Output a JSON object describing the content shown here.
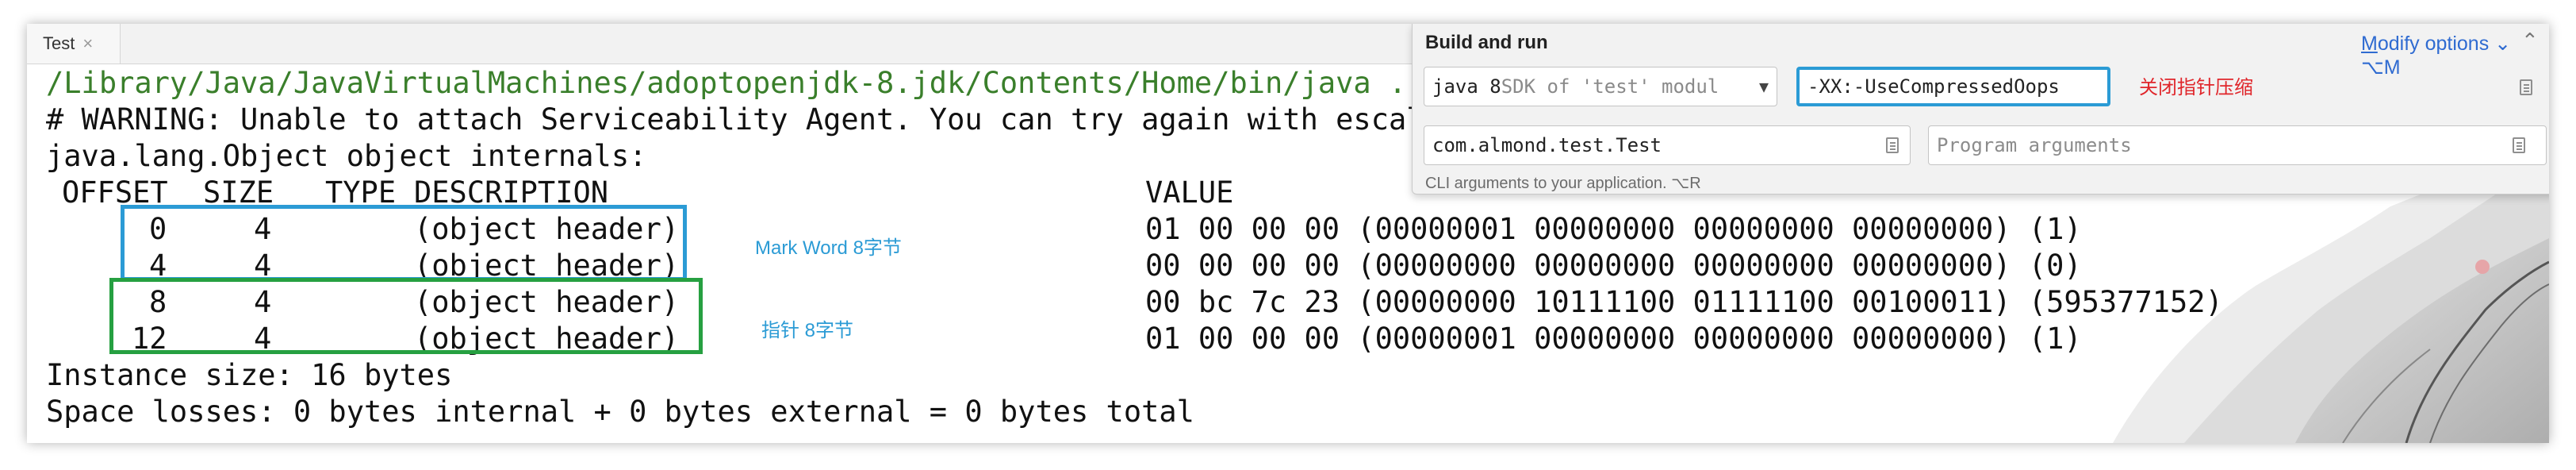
{
  "tabs": [
    {
      "label": "Test",
      "close_glyph": "×"
    }
  ],
  "console": {
    "lines": [
      "/Library/Java/JavaVirtualMachines/adoptopenjdk-8.jdk/Contents/Home/bin/java ...",
      "# WARNING: Unable to attach Serviceability Agent. You can try again with escala",
      "java.lang.Object object internals:"
    ],
    "headers": {
      "offset": "OFFSET",
      "size": "SIZE",
      "type": "TYPE",
      "description": "DESCRIPTION",
      "value": "VALUE"
    },
    "rows": [
      {
        "offset": "0",
        "size": "4",
        "description": "(object header)",
        "value": "01 00 00 00 (00000001 00000000 00000000 00000000) (1)"
      },
      {
        "offset": "4",
        "size": "4",
        "description": "(object header)",
        "value": "00 00 00 00 (00000000 00000000 00000000 00000000) (0)"
      },
      {
        "offset": "8",
        "size": "4",
        "description": "(object header)",
        "value": "00 bc 7c 23 (00000000 10111100 01111100 00100011) (595377152)"
      },
      {
        "offset": "12",
        "size": "4",
        "description": "(object header)",
        "value": "01 00 00 00 (00000001 00000000 00000000 00000000) (1)"
      }
    ],
    "footer": [
      "Instance size: 16 bytes",
      "Space losses: 0 bytes internal + 0 bytes external = 0 bytes total"
    ]
  },
  "annotations": {
    "mark_word": "Mark Word 8字节",
    "pointer": "指针 8字节"
  },
  "build_panel": {
    "title": "Build and run",
    "modify_options_underlined": "M",
    "modify_options_rest": "odify options",
    "modify_options_suffix": "⌥M",
    "collapse_glyph": "⌃",
    "sdk_main": "java 8",
    "sdk_muted": " SDK of 'test' modul",
    "vm_options_value": "-XX:-UseCompressedOops",
    "vm_options_note": "关闭指针压缩",
    "main_class_value": "com.almond.test.Test",
    "program_args_placeholder": "Program arguments",
    "hint": "CLI arguments to your application. ⌥R"
  },
  "colors": {
    "command_green": "#3a7f2b",
    "mark_box_blue": "#2b9bd5",
    "pointer_box_green": "#26a041",
    "note_red": "#e0262b",
    "link_blue": "#2f6bd1"
  },
  "icons": [
    "close-icon",
    "chevron-down-icon",
    "document-icon",
    "collapse-icon"
  ]
}
